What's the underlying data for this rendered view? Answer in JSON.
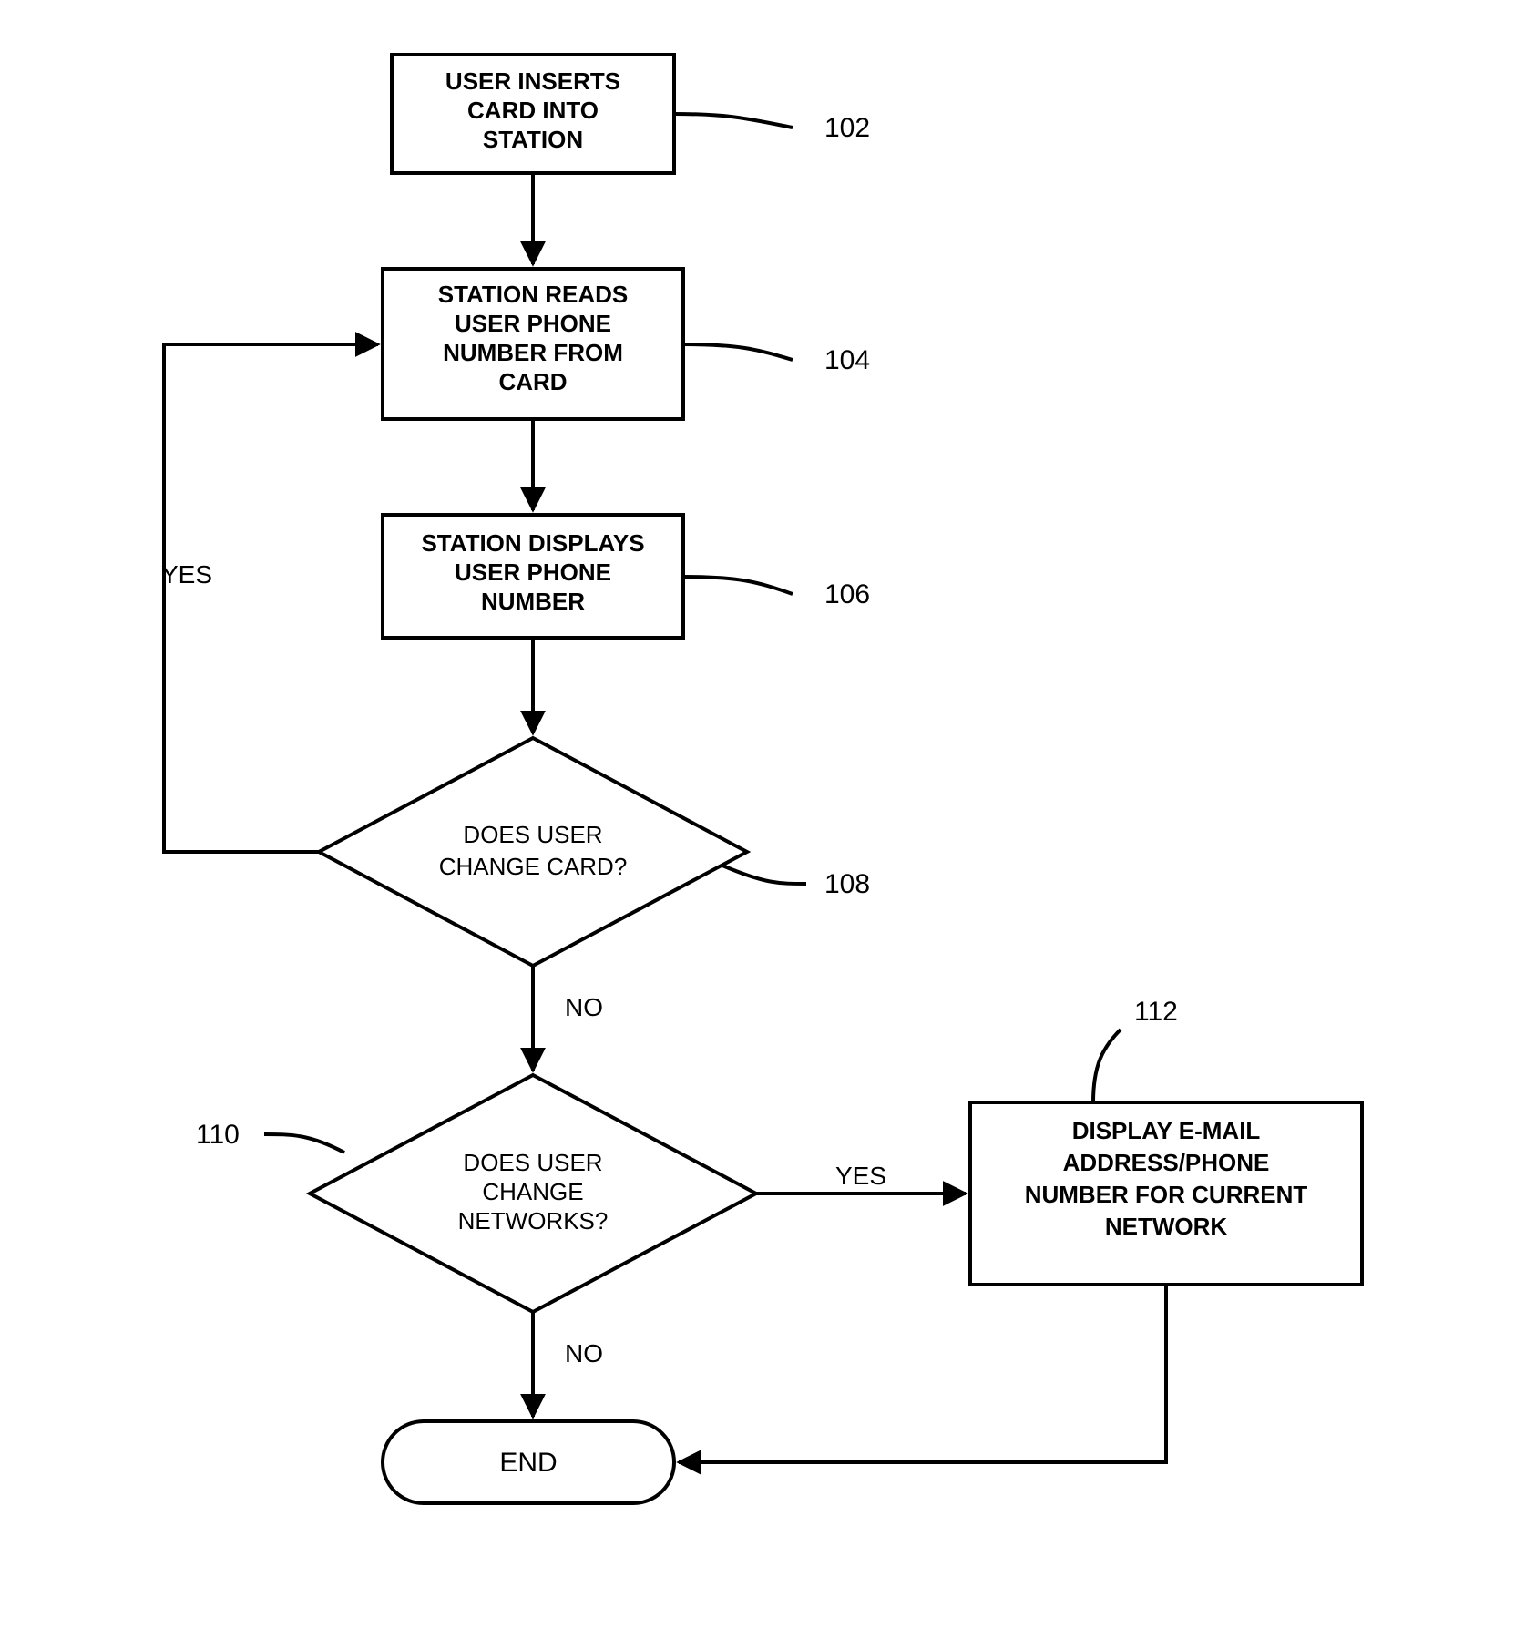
{
  "nodes": {
    "n102": {
      "text": "USER INSERTS CARD INTO STATION",
      "label": "102"
    },
    "n104": {
      "text": "STATION READS USER PHONE NUMBER FROM CARD",
      "label": "104"
    },
    "n106": {
      "text": "STATION DISPLAYS USER PHONE NUMBER",
      "label": "106"
    },
    "n108": {
      "text": "DOES USER CHANGE CARD?",
      "label": "108"
    },
    "n110": {
      "text": "DOES USER CHANGE NETWORKS?",
      "label": "110"
    },
    "n112": {
      "text": "DISPLAY E-MAIL ADDRESS/PHONE NUMBER FOR CURRENT NETWORK",
      "label": "112"
    },
    "end": {
      "text": "END"
    }
  },
  "edges": {
    "yes108": "YES",
    "no108": "NO",
    "yes110": "YES",
    "no110": "NO"
  }
}
